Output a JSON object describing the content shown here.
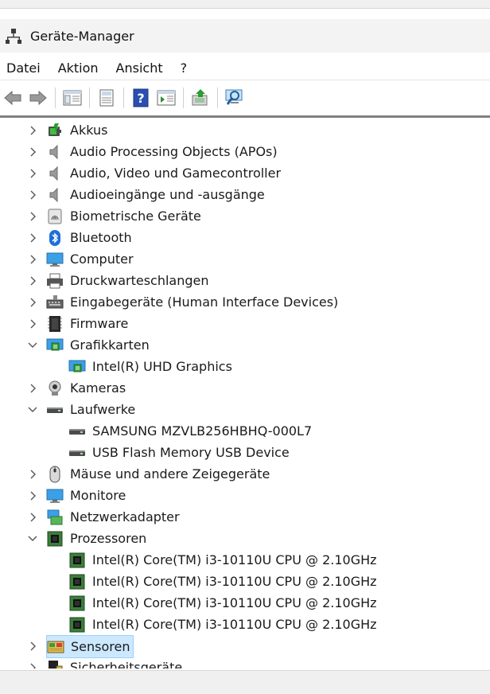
{
  "window": {
    "title": "Geräte-Manager"
  },
  "menu": [
    "Datei",
    "Aktion",
    "Ansicht",
    "?"
  ],
  "toolbar": [
    "back-arrow-icon",
    "forward-arrow-icon",
    "properties-panel-icon",
    "document-icon",
    "help-icon",
    "run-panel-icon",
    "update-driver-icon",
    "scan-hardware-icon"
  ],
  "tree": [
    {
      "label": "Akkus",
      "icon": "battery-icon",
      "level": 0,
      "expander": "collapsed"
    },
    {
      "label": "Audio Processing Objects (APOs)",
      "icon": "speaker-icon",
      "level": 0,
      "expander": "collapsed"
    },
    {
      "label": "Audio, Video und Gamecontroller",
      "icon": "speaker-icon",
      "level": 0,
      "expander": "collapsed"
    },
    {
      "label": "Audioeingänge und -ausgänge",
      "icon": "speaker-icon",
      "level": 0,
      "expander": "collapsed"
    },
    {
      "label": "Biometrische Geräte",
      "icon": "fingerprint-icon",
      "level": 0,
      "expander": "collapsed"
    },
    {
      "label": "Bluetooth",
      "icon": "bluetooth-icon",
      "level": 0,
      "expander": "collapsed"
    },
    {
      "label": "Computer",
      "icon": "monitor-icon",
      "level": 0,
      "expander": "collapsed"
    },
    {
      "label": "Druckwarteschlangen",
      "icon": "printer-icon",
      "level": 0,
      "expander": "collapsed"
    },
    {
      "label": "Eingabegeräte (Human Interface Devices)",
      "icon": "keyboard-icon",
      "level": 0,
      "expander": "collapsed"
    },
    {
      "label": "Firmware",
      "icon": "firmware-chip-icon",
      "level": 0,
      "expander": "collapsed"
    },
    {
      "label": "Grafikkarten",
      "icon": "display-adapter-icon",
      "level": 0,
      "expander": "expanded"
    },
    {
      "label": "Intel(R) UHD Graphics",
      "icon": "display-adapter-icon",
      "level": 1,
      "expander": "none"
    },
    {
      "label": "Kameras",
      "icon": "webcam-icon",
      "level": 0,
      "expander": "collapsed"
    },
    {
      "label": "Laufwerke",
      "icon": "drive-icon",
      "level": 0,
      "expander": "expanded"
    },
    {
      "label": "SAMSUNG MZVLB256HBHQ-000L7",
      "icon": "drive-icon",
      "level": 1,
      "expander": "none"
    },
    {
      "label": "USB Flash Memory USB Device",
      "icon": "drive-icon",
      "level": 1,
      "expander": "none"
    },
    {
      "label": "Mäuse und andere Zeigegeräte",
      "icon": "mouse-icon",
      "level": 0,
      "expander": "collapsed"
    },
    {
      "label": "Monitore",
      "icon": "monitor-icon",
      "level": 0,
      "expander": "collapsed"
    },
    {
      "label": "Netzwerkadapter",
      "icon": "network-icon",
      "level": 0,
      "expander": "collapsed"
    },
    {
      "label": "Prozessoren",
      "icon": "cpu-icon",
      "level": 0,
      "expander": "expanded"
    },
    {
      "label": "Intel(R) Core(TM) i3-10110U CPU @ 2.10GHz",
      "icon": "cpu-icon",
      "level": 1,
      "expander": "none"
    },
    {
      "label": "Intel(R) Core(TM) i3-10110U CPU @ 2.10GHz",
      "icon": "cpu-icon",
      "level": 1,
      "expander": "none"
    },
    {
      "label": "Intel(R) Core(TM) i3-10110U CPU @ 2.10GHz",
      "icon": "cpu-icon",
      "level": 1,
      "expander": "none"
    },
    {
      "label": "Intel(R) Core(TM) i3-10110U CPU @ 2.10GHz",
      "icon": "cpu-icon",
      "level": 1,
      "expander": "none"
    },
    {
      "label": "Sensoren",
      "icon": "sensor-icon",
      "level": 0,
      "expander": "collapsed",
      "selected": true
    },
    {
      "label": "Sicherheitsgeräte",
      "icon": "security-device-icon",
      "level": 0,
      "expander": "collapsed"
    }
  ]
}
